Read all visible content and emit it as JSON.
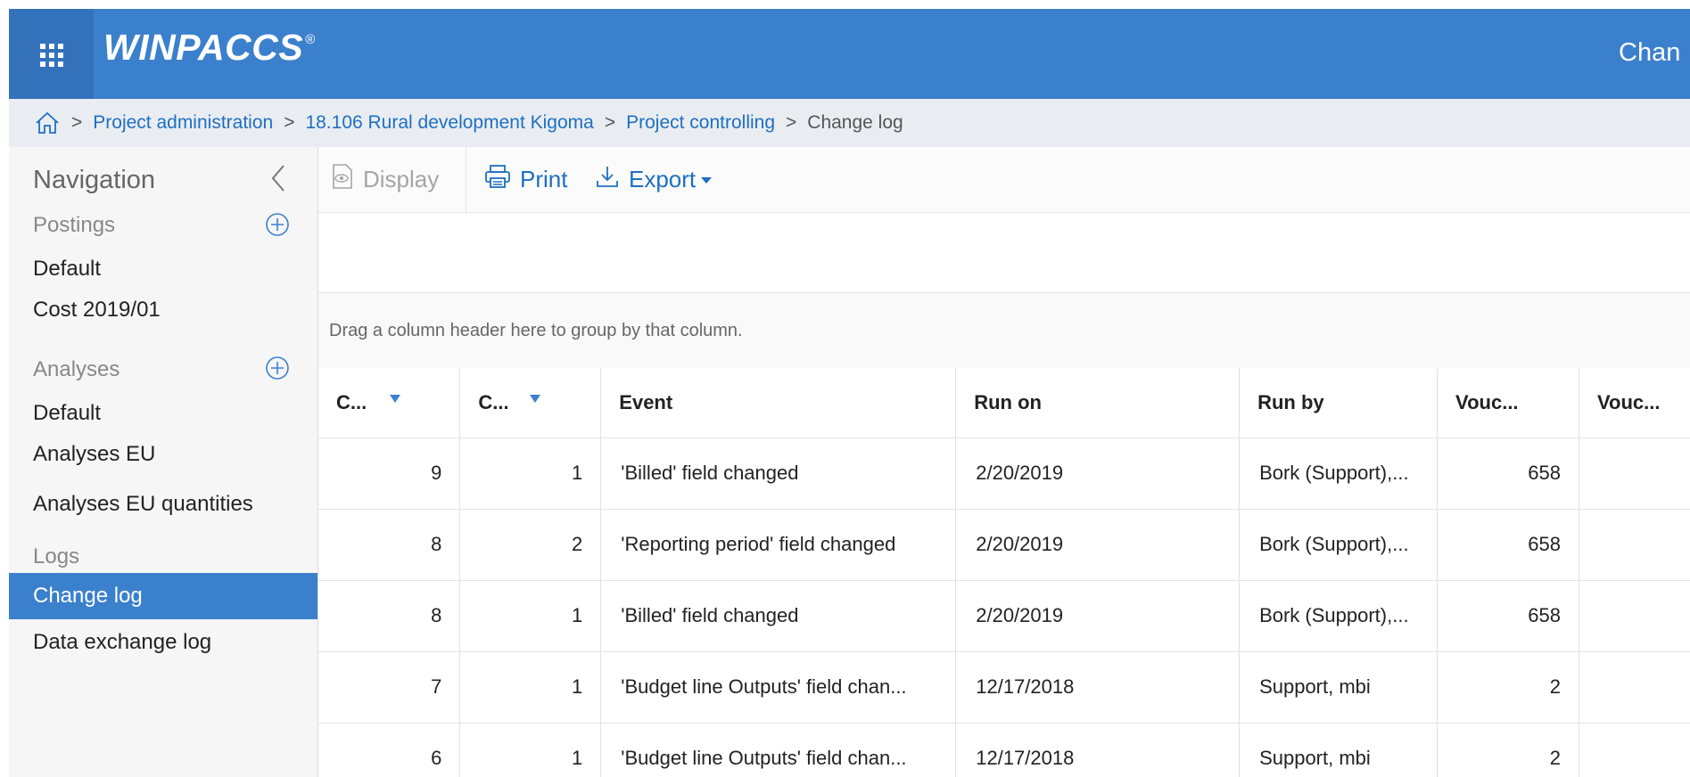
{
  "app": {
    "brand": "WINPACCS",
    "brand_mark": "®",
    "header_right": "Chan"
  },
  "breadcrumb": {
    "items": [
      "Project administration",
      "18.106 Rural development Kigoma",
      "Project controlling"
    ],
    "current": "Change log",
    "separator": ">"
  },
  "sidebar": {
    "title": "Navigation",
    "postings": {
      "label": "Postings",
      "items": [
        "Default",
        "Cost 2019/01"
      ]
    },
    "analyses": {
      "label": "Analyses",
      "items": [
        "Default",
        "Analyses EU",
        "Analyses EU quantities"
      ]
    },
    "logs": {
      "label": "Logs",
      "items": [
        "Change log",
        "Data exchange log"
      ],
      "active": "Change log"
    }
  },
  "toolbar": {
    "display_label": "Display",
    "print_label": "Print",
    "export_label": "Export"
  },
  "grid": {
    "group_hint": "Drag a column header here to group by that column.",
    "columns": [
      "C...",
      "C...",
      "Event",
      "Run on",
      "Run by",
      "Vouc...",
      "Vouc..."
    ],
    "rows": [
      [
        "9",
        "1",
        "'Billed' field changed",
        "2/20/2019",
        "Bork (Support),...",
        "658",
        ""
      ],
      [
        "8",
        "2",
        "'Reporting period' field changed",
        "2/20/2019",
        "Bork (Support),...",
        "658",
        ""
      ],
      [
        "8",
        "1",
        "'Billed' field changed",
        "2/20/2019",
        "Bork (Support),...",
        "658",
        ""
      ],
      [
        "7",
        "1",
        "'Budget line Outputs' field chan...",
        "12/17/2018",
        "Support, mbi",
        "2",
        ""
      ],
      [
        "6",
        "1",
        "'Budget line Outputs' field chan...",
        "12/17/2018",
        "Support, mbi",
        "2",
        ""
      ]
    ]
  },
  "colors": {
    "accent": "#3b80cd",
    "accent_dark": "#3371bb",
    "link": "#1e6fc2"
  }
}
